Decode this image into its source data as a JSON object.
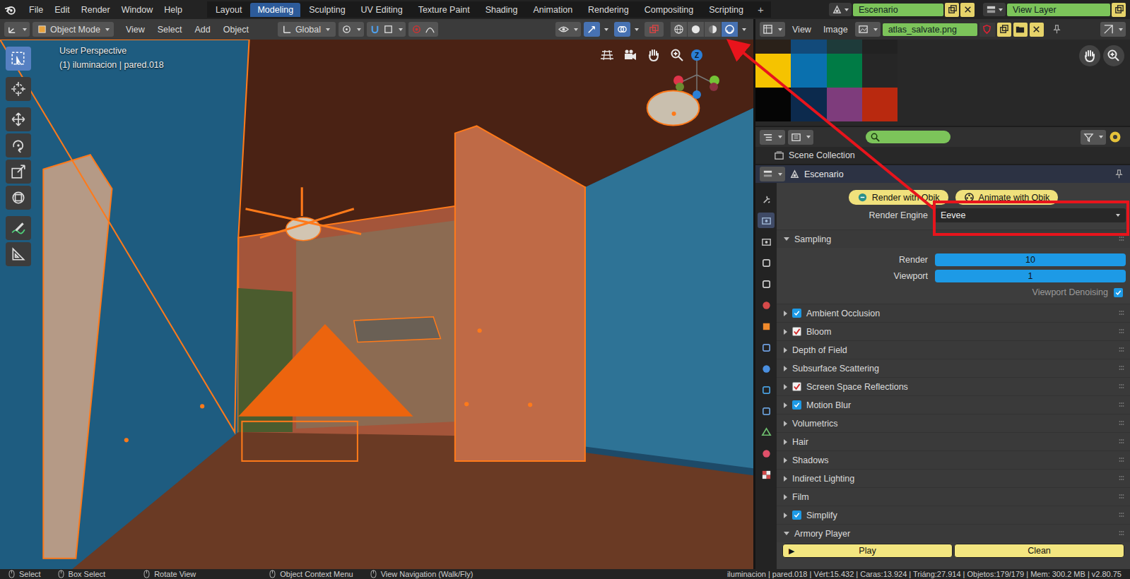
{
  "topbar": {
    "menus": [
      "File",
      "Edit",
      "Render",
      "Window",
      "Help"
    ],
    "workspaces": [
      {
        "label": "Layout",
        "selected": false
      },
      {
        "label": "Modeling",
        "selected": true
      },
      {
        "label": "Sculpting",
        "selected": false
      },
      {
        "label": "UV Editing",
        "selected": false
      },
      {
        "label": "Texture Paint",
        "selected": false
      },
      {
        "label": "Shading",
        "selected": false
      },
      {
        "label": "Animation",
        "selected": false
      },
      {
        "label": "Rendering",
        "selected": false
      },
      {
        "label": "Compositing",
        "selected": false
      },
      {
        "label": "Scripting",
        "selected": false
      }
    ],
    "add_workspace": "+",
    "scene": "Escenario",
    "view_layer": "View Layer"
  },
  "viewport_header": {
    "mode": "Object Mode",
    "menus": [
      "View",
      "Select",
      "Add",
      "Object"
    ],
    "orientation": "Global",
    "shading": [
      {
        "kind": "wireframe",
        "selected": false
      },
      {
        "kind": "solid",
        "selected": false
      },
      {
        "kind": "material",
        "selected": false
      },
      {
        "kind": "rendered",
        "selected": true
      }
    ]
  },
  "toolbar": [
    {
      "kind": "select",
      "selected": true
    },
    {
      "kind": "cursor",
      "selected": false
    },
    {
      "kind": "move",
      "selected": false
    },
    {
      "kind": "rotate",
      "selected": false
    },
    {
      "kind": "scale",
      "selected": false
    },
    {
      "kind": "transform",
      "selected": false
    },
    {
      "kind": "annotate",
      "selected": false
    },
    {
      "kind": "measure",
      "selected": false
    }
  ],
  "viewport": {
    "view_name": "User Perspective",
    "object_info": "(1) iluminacion | pared.018",
    "gizmo_label": "Z"
  },
  "image_editor": {
    "menus": [
      "View",
      "Image"
    ],
    "image_name": "atlas_salvate.png"
  },
  "outliner": {
    "root": "Scene Collection"
  },
  "properties": {
    "context": "Escenario",
    "tabs": [
      {
        "kind": "tool",
        "selected": false
      },
      {
        "kind": "render",
        "selected": true
      },
      {
        "kind": "output",
        "selected": false
      },
      {
        "kind": "view-layer",
        "selected": false
      },
      {
        "kind": "scene",
        "selected": false
      },
      {
        "kind": "world",
        "selected": false
      },
      {
        "kind": "object",
        "selected": false
      },
      {
        "kind": "modifiers",
        "selected": false
      },
      {
        "kind": "particles",
        "selected": false
      },
      {
        "kind": "physics",
        "selected": false
      },
      {
        "kind": "constraints",
        "selected": false
      },
      {
        "kind": "data",
        "selected": false
      },
      {
        "kind": "material",
        "selected": false
      },
      {
        "kind": "texture",
        "selected": false
      }
    ],
    "addon_buttons": [
      "Render with Qbik",
      "Animate with Qbik"
    ],
    "render_engine": {
      "label": "Render Engine",
      "value": "Eevee"
    },
    "sampling": {
      "title": "Sampling",
      "expanded": true,
      "fields": [
        {
          "label": "Render",
          "value": "10"
        },
        {
          "label": "Viewport",
          "value": "1"
        }
      ],
      "denoising": {
        "label": "Viewport Denoising",
        "checked": true
      }
    },
    "panels": [
      {
        "label": "Ambient Occlusion",
        "kind": "toggle",
        "checked": true,
        "expanded": false
      },
      {
        "label": "Bloom",
        "kind": "tick",
        "checked": true,
        "expanded": false
      },
      {
        "label": "Depth of Field",
        "kind": "plain",
        "expanded": false
      },
      {
        "label": "Subsurface Scattering",
        "kind": "plain",
        "expanded": false
      },
      {
        "label": "Screen Space Reflections",
        "kind": "tick",
        "checked": true,
        "expanded": false
      },
      {
        "label": "Motion Blur",
        "kind": "toggle",
        "checked": true,
        "expanded": false
      },
      {
        "label": "Volumetrics",
        "kind": "plain",
        "expanded": false
      },
      {
        "label": "Hair",
        "kind": "plain",
        "expanded": false
      },
      {
        "label": "Shadows",
        "kind": "plain",
        "expanded": false
      },
      {
        "label": "Indirect Lighting",
        "kind": "plain",
        "expanded": false
      },
      {
        "label": "Film",
        "kind": "plain",
        "expanded": false
      },
      {
        "label": "Simplify",
        "kind": "toggle",
        "checked": true,
        "expanded": false
      }
    ],
    "armory": {
      "title": "Armory Player",
      "expanded": true,
      "play": {
        "icon": "▶",
        "label": "Play"
      },
      "clean": {
        "label": "Clean"
      }
    }
  },
  "status_bar": {
    "hints": [
      "Select",
      "Box Select",
      "Rotate View",
      "Object Context Menu",
      "View Navigation (Walk/Fly)"
    ],
    "stats": "iluminacion | pared.018 | Vért:15.432 | Caras:13.924 | Triáng:27.914 | Objetos:179/179 | Mem: 300.2 MB | v2.80.75"
  }
}
